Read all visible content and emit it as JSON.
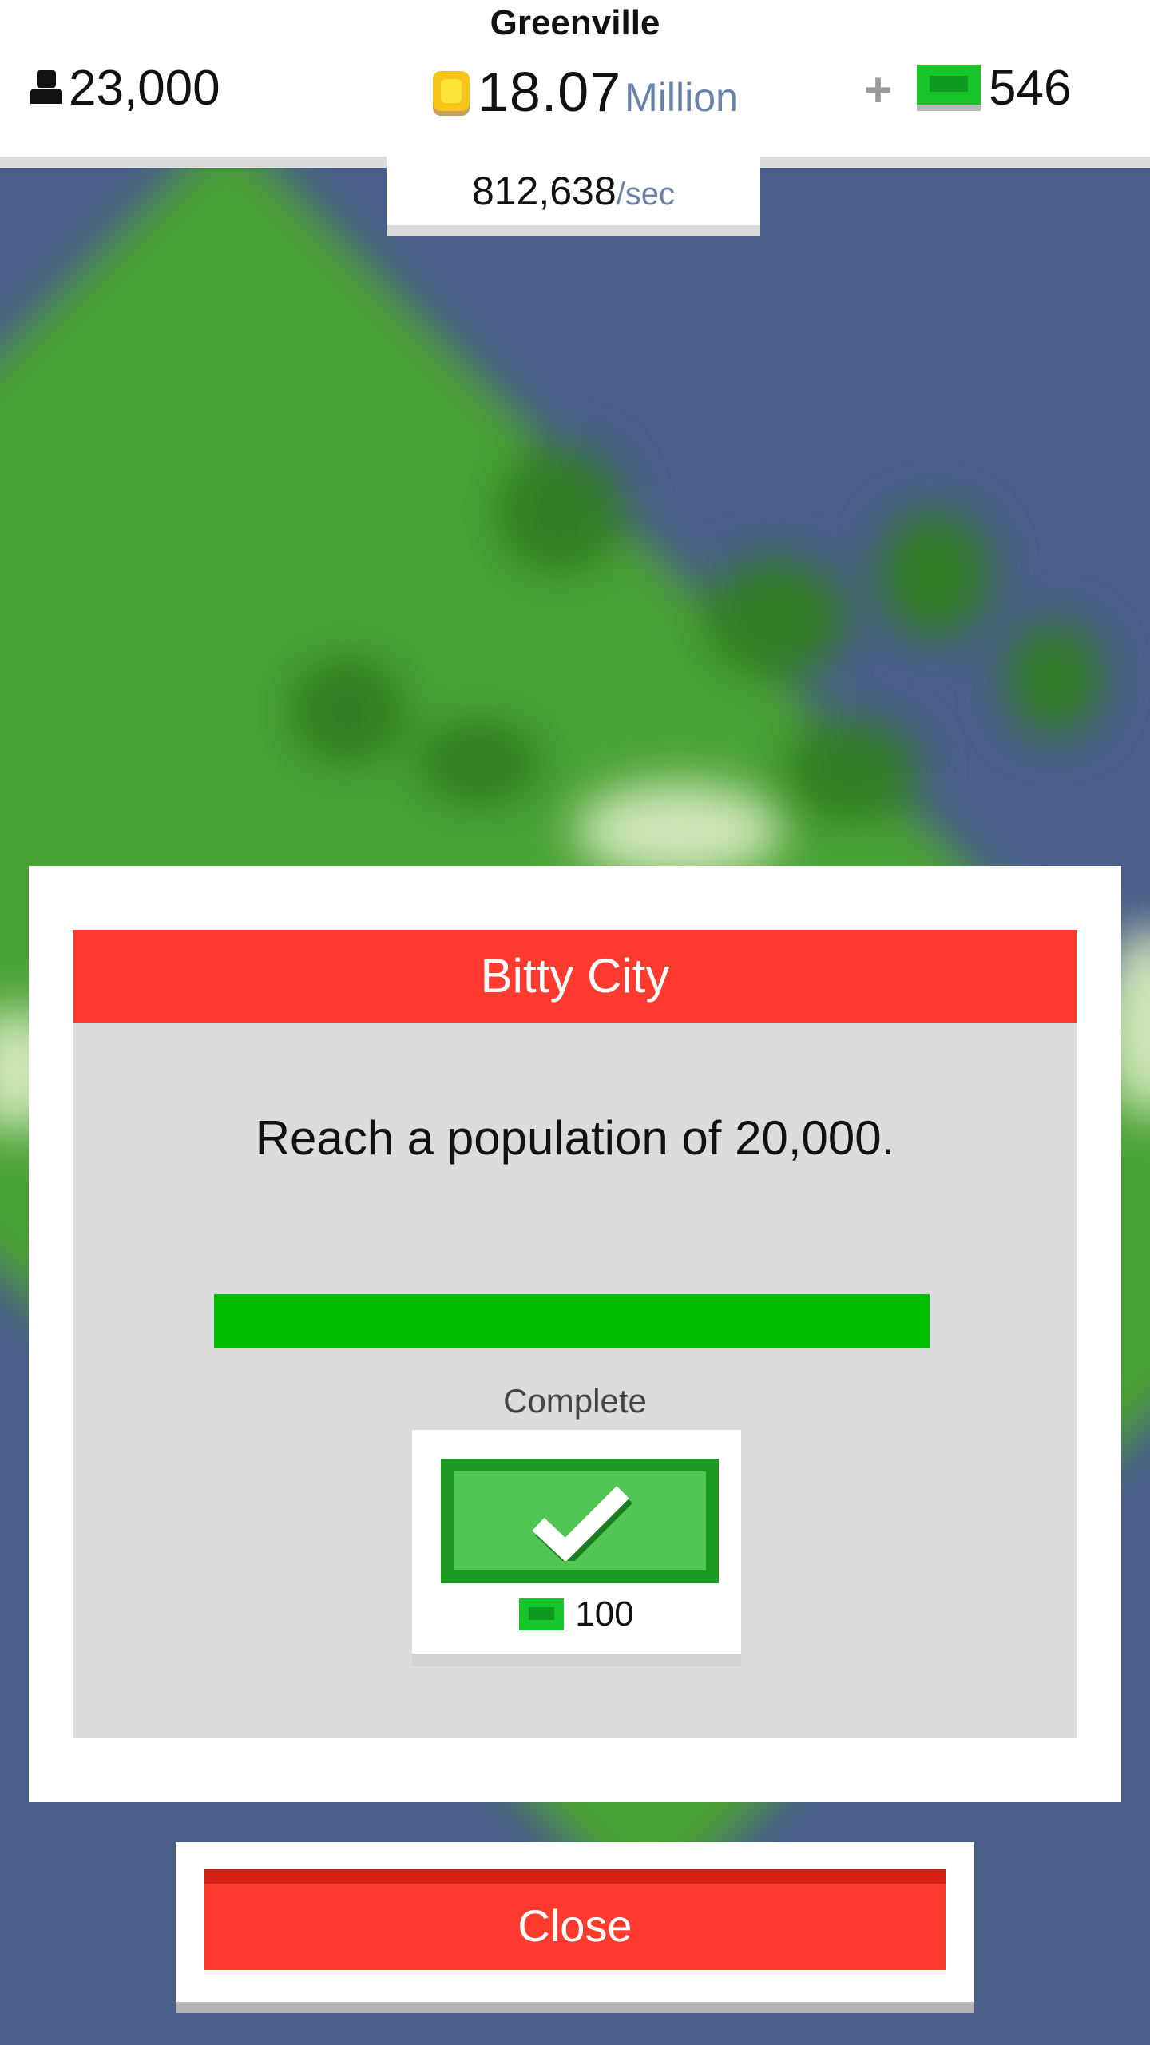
{
  "hud": {
    "city_name": "Greenville",
    "population": "23,000",
    "coins_value": "18.07",
    "coins_unit": "Million",
    "plus_label": "+",
    "cash_value": "546",
    "rate_value": "812,638",
    "rate_unit": "/sec",
    "icons": {
      "population": "person-icon",
      "coins": "coin-icon",
      "cash": "cash-icon"
    }
  },
  "goal": {
    "title": "Bitty City",
    "description": "Reach a population of 20,000.",
    "progress": 1.0,
    "status": "Complete",
    "reward_amount": "100",
    "claim_icon": "checkmark-icon",
    "reward_icon": "cash-icon"
  },
  "actions": {
    "close_label": "Close"
  },
  "colors": {
    "header_red": "#ff3b2f",
    "progress_green": "#00bf00",
    "claim_green": "#4fc553",
    "claim_border": "#1c9a22",
    "cash_green": "#19c42a",
    "coin_yellow": "#f7c51a",
    "sky_blue": "#4a5e8a",
    "unit_blue": "#6a82a8"
  }
}
